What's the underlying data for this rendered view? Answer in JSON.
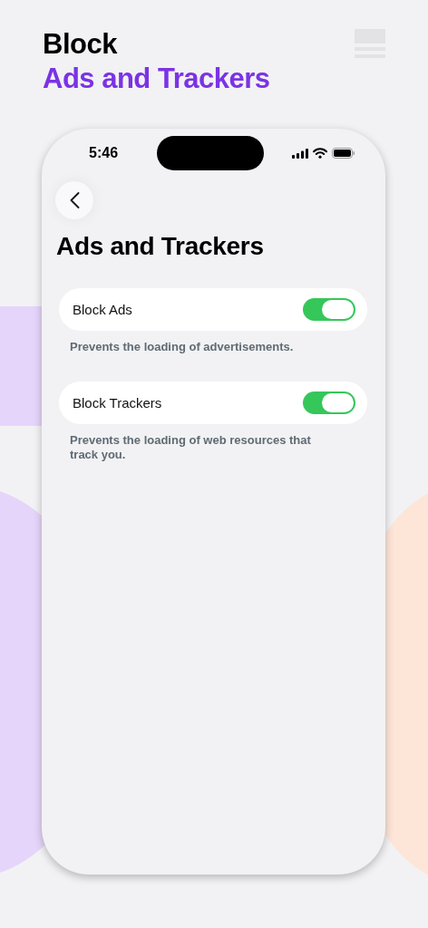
{
  "headline": {
    "line_1": "Block",
    "line_2": "Ads and Trackers"
  },
  "status_bar": {
    "time": "5:46"
  },
  "screen_title": "Ads and Trackers",
  "settings": [
    {
      "label": "Block Ads",
      "on": true,
      "description": "Prevents the loading of advertisements."
    },
    {
      "label": "Block Trackers",
      "on": true,
      "description": "Prevents the loading of web resources that track you."
    }
  ]
}
